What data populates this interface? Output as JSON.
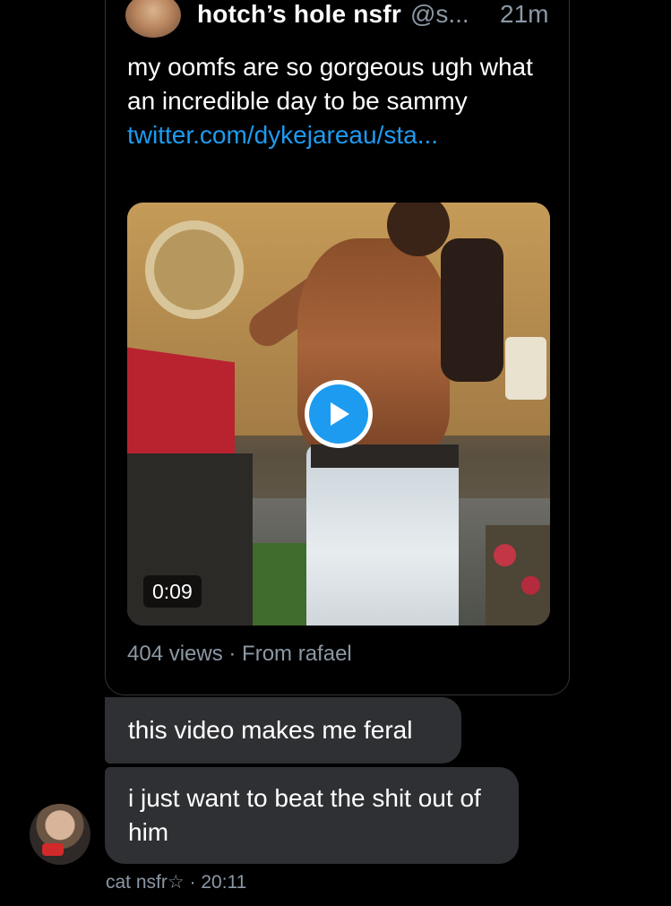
{
  "quoted_tweet": {
    "author_name": "hotch’s hole nsfr",
    "author_handle": "@s...",
    "time_ago": "21m",
    "text": "my oomfs are so gorgeous ugh what an incredible day to be sammy ",
    "link_text": "twitter.com/dykejareau/sta...",
    "video": {
      "duration": "0:09",
      "play_icon": "play-icon"
    },
    "meta": "404 views · From rafael"
  },
  "messages": [
    {
      "text": "this video makes me feral"
    },
    {
      "text": "i just want to beat the shit out of him"
    }
  ],
  "sender": {
    "name": "cat nsfr☆",
    "time": "· 20:11"
  },
  "colors": {
    "background": "#000000",
    "bubble": "#2f3033",
    "link": "#1d9bf0",
    "muted": "#8b98a5"
  }
}
